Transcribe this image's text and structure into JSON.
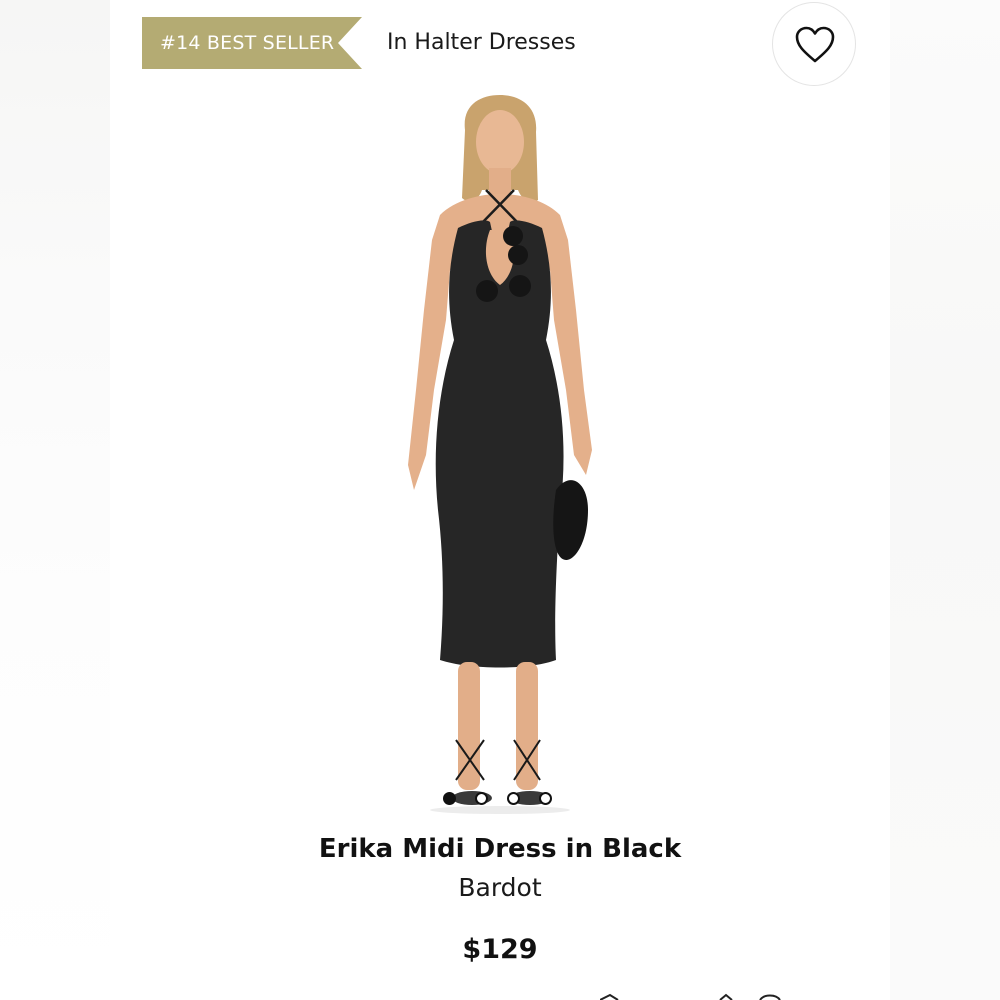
{
  "badge": {
    "text": "#14 BEST SELLER",
    "color": "#b4ab73"
  },
  "category": {
    "label": "In Halter Dresses"
  },
  "favorite": {
    "icon": "heart-outline-icon"
  },
  "product": {
    "title": "Erika Midi Dress in Black",
    "brand": "Bardot",
    "price": "$129"
  },
  "carousel": {
    "total": 4,
    "active_index": 1
  }
}
